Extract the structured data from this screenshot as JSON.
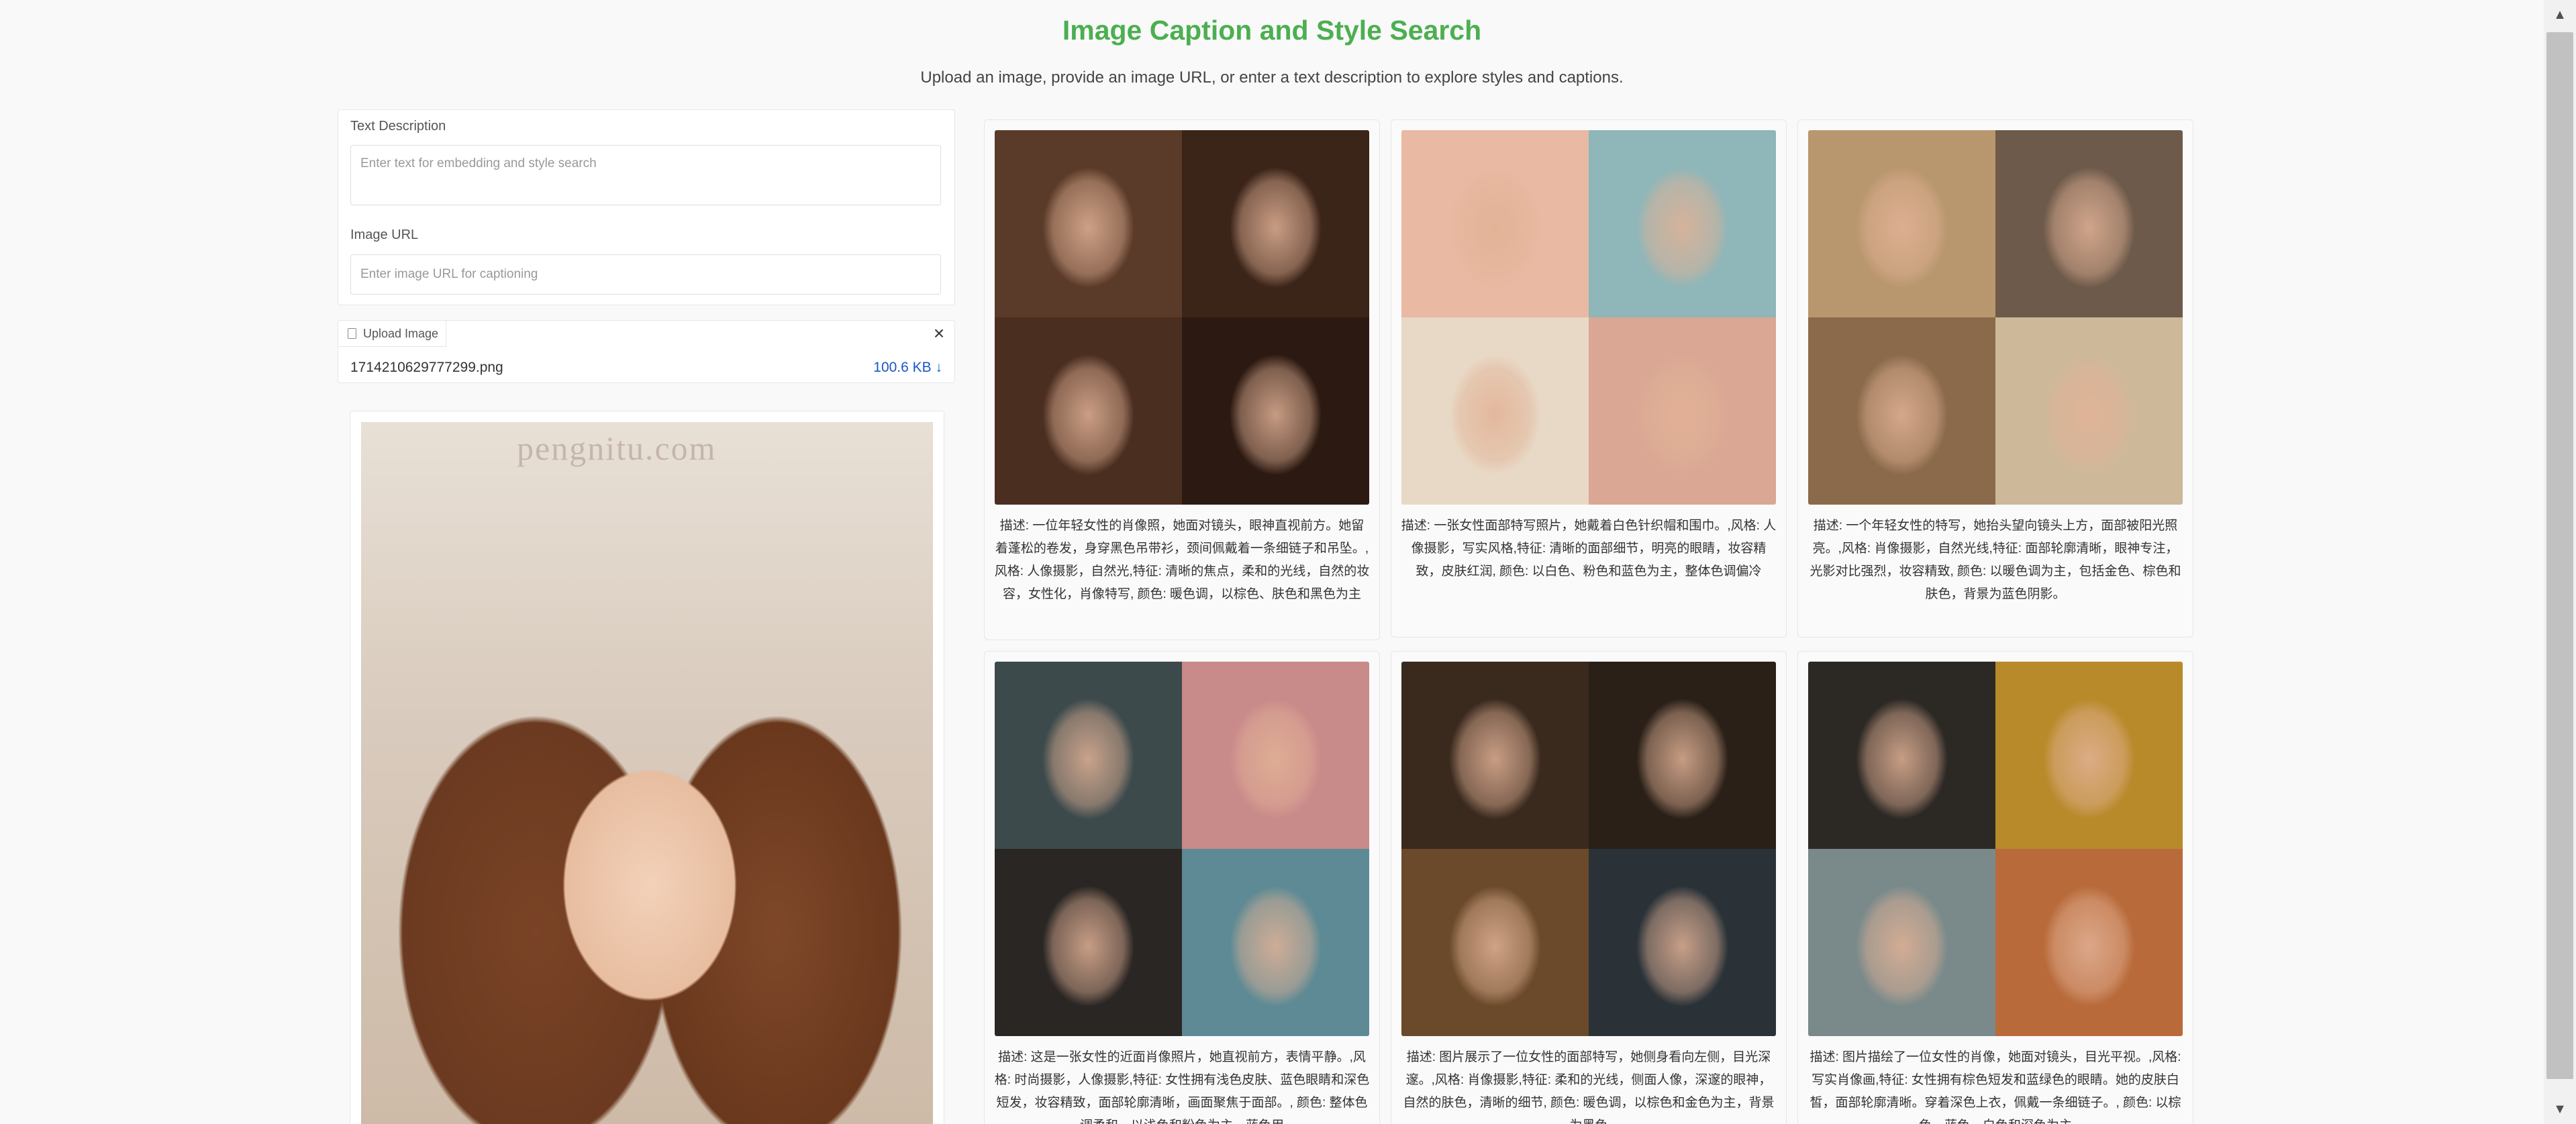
{
  "header": {
    "title": "Image Caption and Style Search",
    "subtitle": "Upload an image, provide an image URL, or enter a text description to explore styles and captions."
  },
  "form": {
    "text_label": "Text Description",
    "text_placeholder": "Enter text for embedding and style search",
    "url_label": "Image URL",
    "url_placeholder": "Enter image URL for captioning"
  },
  "upload": {
    "tab_label": "Upload Image",
    "close_label": "×",
    "file_name": "1714210629777299.png",
    "file_size": "100.6 KB ↓"
  },
  "preview": {
    "watermark": "pengnitu.com"
  },
  "results": [
    {
      "caption": "描述: 一位年轻女性的肖像照，她面对镜头，眼神直视前方。她留着蓬松的卷发，身穿黑色吊带衫，颈间佩戴着一条细链子和吊坠。,风格: 人像摄影，自然光,特征: 清晰的焦点，柔和的光线，自然的妆容，女性化，肖像特写, 颜色: 暖色调，以棕色、肤色和黑色为主",
      "palette": [
        "#5a3a28",
        "#3b2418",
        "#4a2e20",
        "#2c1a12"
      ]
    },
    {
      "caption": "描述: 一张女性面部特写照片，她戴着白色针织帽和围巾。,风格: 人像摄影，写实风格,特征: 清晰的面部细节，明亮的眼睛，妆容精致，皮肤红润, 颜色: 以白色、粉色和蓝色为主，整体色调偏冷",
      "palette": [
        "#e9b9a3",
        "#8fb6b8",
        "#e8d9c6",
        "#d9a794"
      ]
    },
    {
      "caption": "描述: 一个年轻女性的特写，她抬头望向镜头上方，面部被阳光照亮。,风格: 肖像摄影，自然光线,特征: 面部轮廓清晰，眼神专注，光影对比强烈，妆容精致, 颜色: 以暖色调为主，包括金色、棕色和肤色，背景为蓝色阴影。",
      "palette": [
        "#b9976e",
        "#6e5a4a",
        "#8a6a4a",
        "#cdb89a"
      ]
    },
    {
      "caption": "描述: 这是一张女性的近面肖像照片，她直视前方，表情平静。,风格: 时尚摄影，人像摄影,特征: 女性拥有浅色皮肤、蓝色眼睛和深色短发，妆容精致，面部轮廓清晰，画面聚焦于面部。, 颜色: 整体色调柔和，以浅色和粉色为主，蓝色用",
      "palette": [
        "#3d4a4c",
        "#c98a8a",
        "#2a2624",
        "#5d8a94"
      ]
    },
    {
      "caption": "描述: 图片展示了一位女性的面部特写，她侧身看向左侧，目光深邃。,风格: 肖像摄影,特征: 柔和的光线，侧面人像，深邃的眼神，自然的肤色，清晰的细节, 颜色: 暖色调，以棕色和金色为主，背景为黑色",
      "palette": [
        "#3a2a1e",
        "#2a2018",
        "#6a4a2a",
        "#2a3238"
      ]
    },
    {
      "caption": "描述: 图片描绘了一位女性的肖像，她面对镜头，目光平视。,风格: 写实肖像画,特征: 女性拥有棕色短发和蓝绿色的眼睛。她的皮肤白皙，面部轮廓清晰。穿着深色上衣，佩戴一条细链子。, 颜色: 以棕色、蓝色、白色和深色为主",
      "palette": [
        "#2c2824",
        "#b88a2a",
        "#7a8a8a",
        "#b86a3a"
      ]
    }
  ]
}
